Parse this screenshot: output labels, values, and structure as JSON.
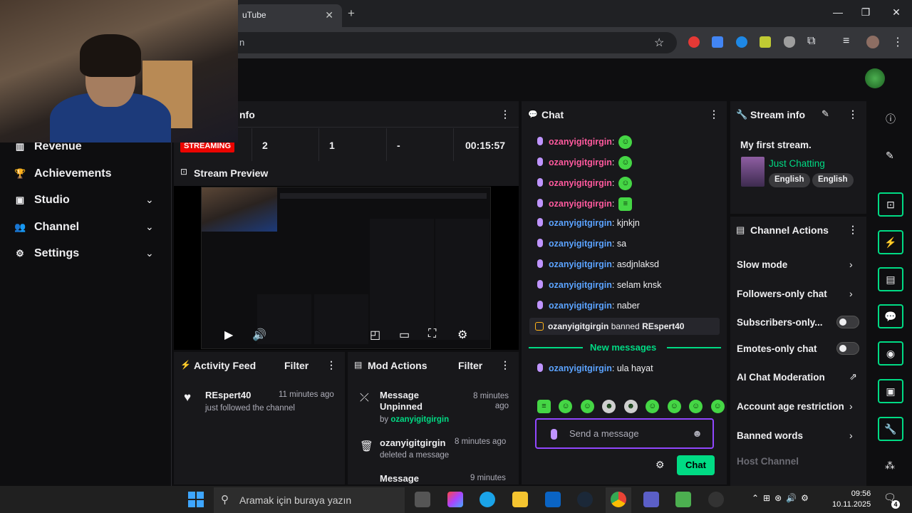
{
  "browser": {
    "tab_title": "uTube",
    "tab_close": "✕",
    "new_tab": "+",
    "omnibox_text": "n",
    "window": {
      "minimize": "—",
      "maximize": "❐",
      "close": "✕"
    }
  },
  "nav": {
    "items": [
      {
        "label": "Revenue",
        "icon": "▥"
      },
      {
        "label": "Achievements",
        "icon": "🏆"
      },
      {
        "label": "Studio",
        "icon": "▣"
      },
      {
        "label": "Channel",
        "icon": "👥"
      },
      {
        "label": "Settings",
        "icon": "⚙"
      }
    ]
  },
  "session": {
    "title_partial": "nfo",
    "status_badge": "STREAMING",
    "stats": [
      "2",
      "1",
      "-",
      "00:15:57"
    ]
  },
  "preview": {
    "title": "Stream Preview"
  },
  "activity": {
    "title": "Activity Feed",
    "filter": "Filter",
    "items": [
      {
        "user": "REspert40",
        "time": "11 minutes ago",
        "text": "just followed the channel"
      }
    ]
  },
  "mod": {
    "title": "Mod Actions",
    "filter": "Filter",
    "items": [
      {
        "title": "Message Unpinned",
        "by_prefix": "by",
        "by": "ozanyigitgirgin",
        "time": "8 minutes ago"
      },
      {
        "title": "ozanyigitgirgin",
        "desc": "deleted a message",
        "time": "8 minutes ago"
      },
      {
        "title": "Message",
        "time": "9 minutes"
      }
    ]
  },
  "chat": {
    "title": "Chat",
    "messages": [
      {
        "user": "ozanyigitgirgin",
        "color": "red",
        "text": "",
        "emote": true
      },
      {
        "user": "ozanyigitgirgin",
        "color": "red",
        "text": "",
        "emote": true
      },
      {
        "user": "ozanyigitgirgin",
        "color": "red",
        "text": "",
        "emote": true
      },
      {
        "user": "ozanyigitgirgin",
        "color": "red",
        "text": "",
        "emote": true
      },
      {
        "user": "ozanyigitgirgin",
        "color": "blue",
        "text": "kjnkjn"
      },
      {
        "user": "ozanyigitgirgin",
        "color": "blue",
        "text": "sa"
      },
      {
        "user": "ozanyigitgirgin",
        "color": "blue",
        "text": "asdjnlaksd"
      },
      {
        "user": "ozanyigitgirgin",
        "color": "blue",
        "text": "selam knsk"
      },
      {
        "user": "ozanyigitgirgin",
        "color": "blue",
        "text": "naber"
      }
    ],
    "ban": {
      "actor": "ozanyigitgirgin",
      "verb": "banned",
      "target": "REspert40"
    },
    "new_messages": "New messages",
    "last": {
      "user": "ozanyigitgirgin",
      "text": "ula hayat"
    },
    "input_placeholder": "Send a message",
    "send_button": "Chat"
  },
  "stream_info": {
    "title": "Stream info",
    "stream_title": "My first stream.",
    "category": "Just Chatting",
    "tags": [
      "English",
      "English"
    ]
  },
  "channel_actions": {
    "title": "Channel Actions",
    "items": [
      {
        "label": "Slow mode",
        "kind": "arrow"
      },
      {
        "label": "Followers-only chat",
        "kind": "arrow"
      },
      {
        "label": "Subscribers-only...",
        "kind": "toggle"
      },
      {
        "label": "Emotes-only chat",
        "kind": "toggle"
      },
      {
        "label": "AI Chat Moderation",
        "kind": "external"
      },
      {
        "label": "Account age restriction",
        "kind": "arrow"
      },
      {
        "label": "Banned words",
        "kind": "arrow"
      },
      {
        "label": "Host Channel",
        "kind": "muted"
      }
    ]
  },
  "taskbar": {
    "search_placeholder": "Aramak için buraya yazın",
    "time": "09:56",
    "date": "10.11.2025",
    "notif_count": "4"
  },
  "colors": {
    "accent": "#00db84",
    "purple": "#9147ff",
    "live": "#eb0400"
  }
}
